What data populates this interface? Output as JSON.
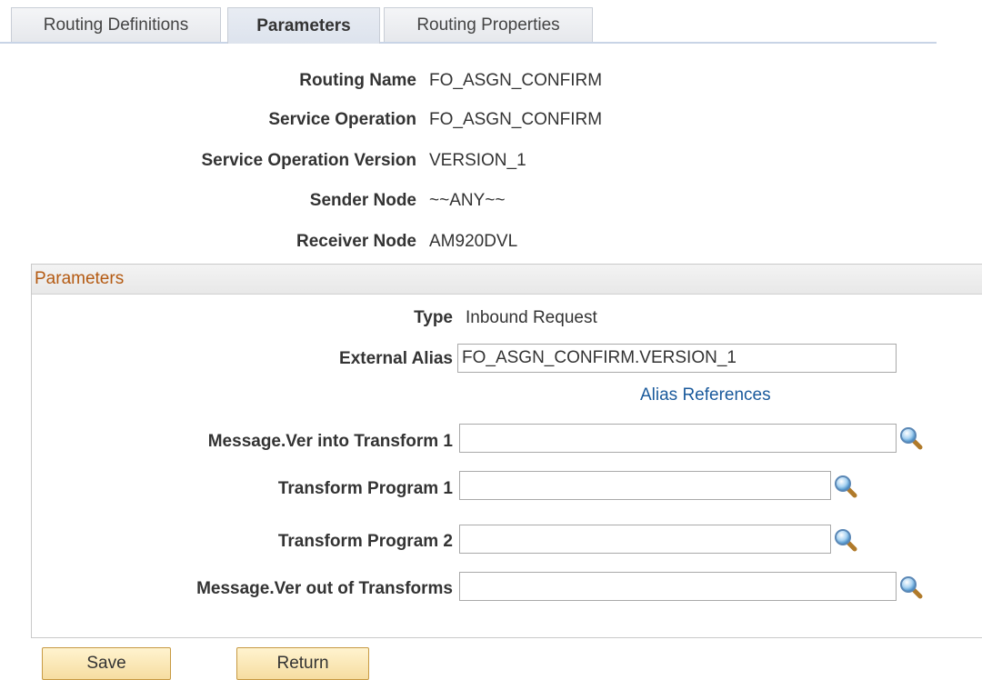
{
  "tabs": [
    {
      "label": "Routing Definitions",
      "active": false
    },
    {
      "label": "Parameters",
      "active": true
    },
    {
      "label": "Routing Properties",
      "active": false
    }
  ],
  "info": {
    "routing_name": {
      "label": "Routing Name",
      "value": "FO_ASGN_CONFIRM"
    },
    "service_operation": {
      "label": "Service Operation",
      "value": "FO_ASGN_CONFIRM"
    },
    "service_operation_version": {
      "label": "Service Operation Version",
      "value": "VERSION_1"
    },
    "sender_node": {
      "label": "Sender Node",
      "value": "~~ANY~~"
    },
    "receiver_node": {
      "label": "Receiver Node",
      "value": "AM920DVL"
    }
  },
  "parameters": {
    "header": "Parameters",
    "type": {
      "label": "Type",
      "value": "Inbound Request"
    },
    "external_alias": {
      "label": "External Alias",
      "value": "FO_ASGN_CONFIRM.VERSION_1"
    },
    "alias_references_link": "Alias References",
    "msg_into_transform": {
      "label": "Message.Ver into Transform 1",
      "value": ""
    },
    "transform_program_1": {
      "label": "Transform Program 1",
      "value": ""
    },
    "transform_program_2": {
      "label": "Transform Program 2",
      "value": ""
    },
    "msg_out_of_transforms": {
      "label": "Message.Ver out of Transforms",
      "value": ""
    }
  },
  "buttons": {
    "save": "Save",
    "return": "Return"
  },
  "colors": {
    "group_header_text": "#b45a12",
    "link": "#1a5a9c",
    "button_border": "#c79a43"
  }
}
